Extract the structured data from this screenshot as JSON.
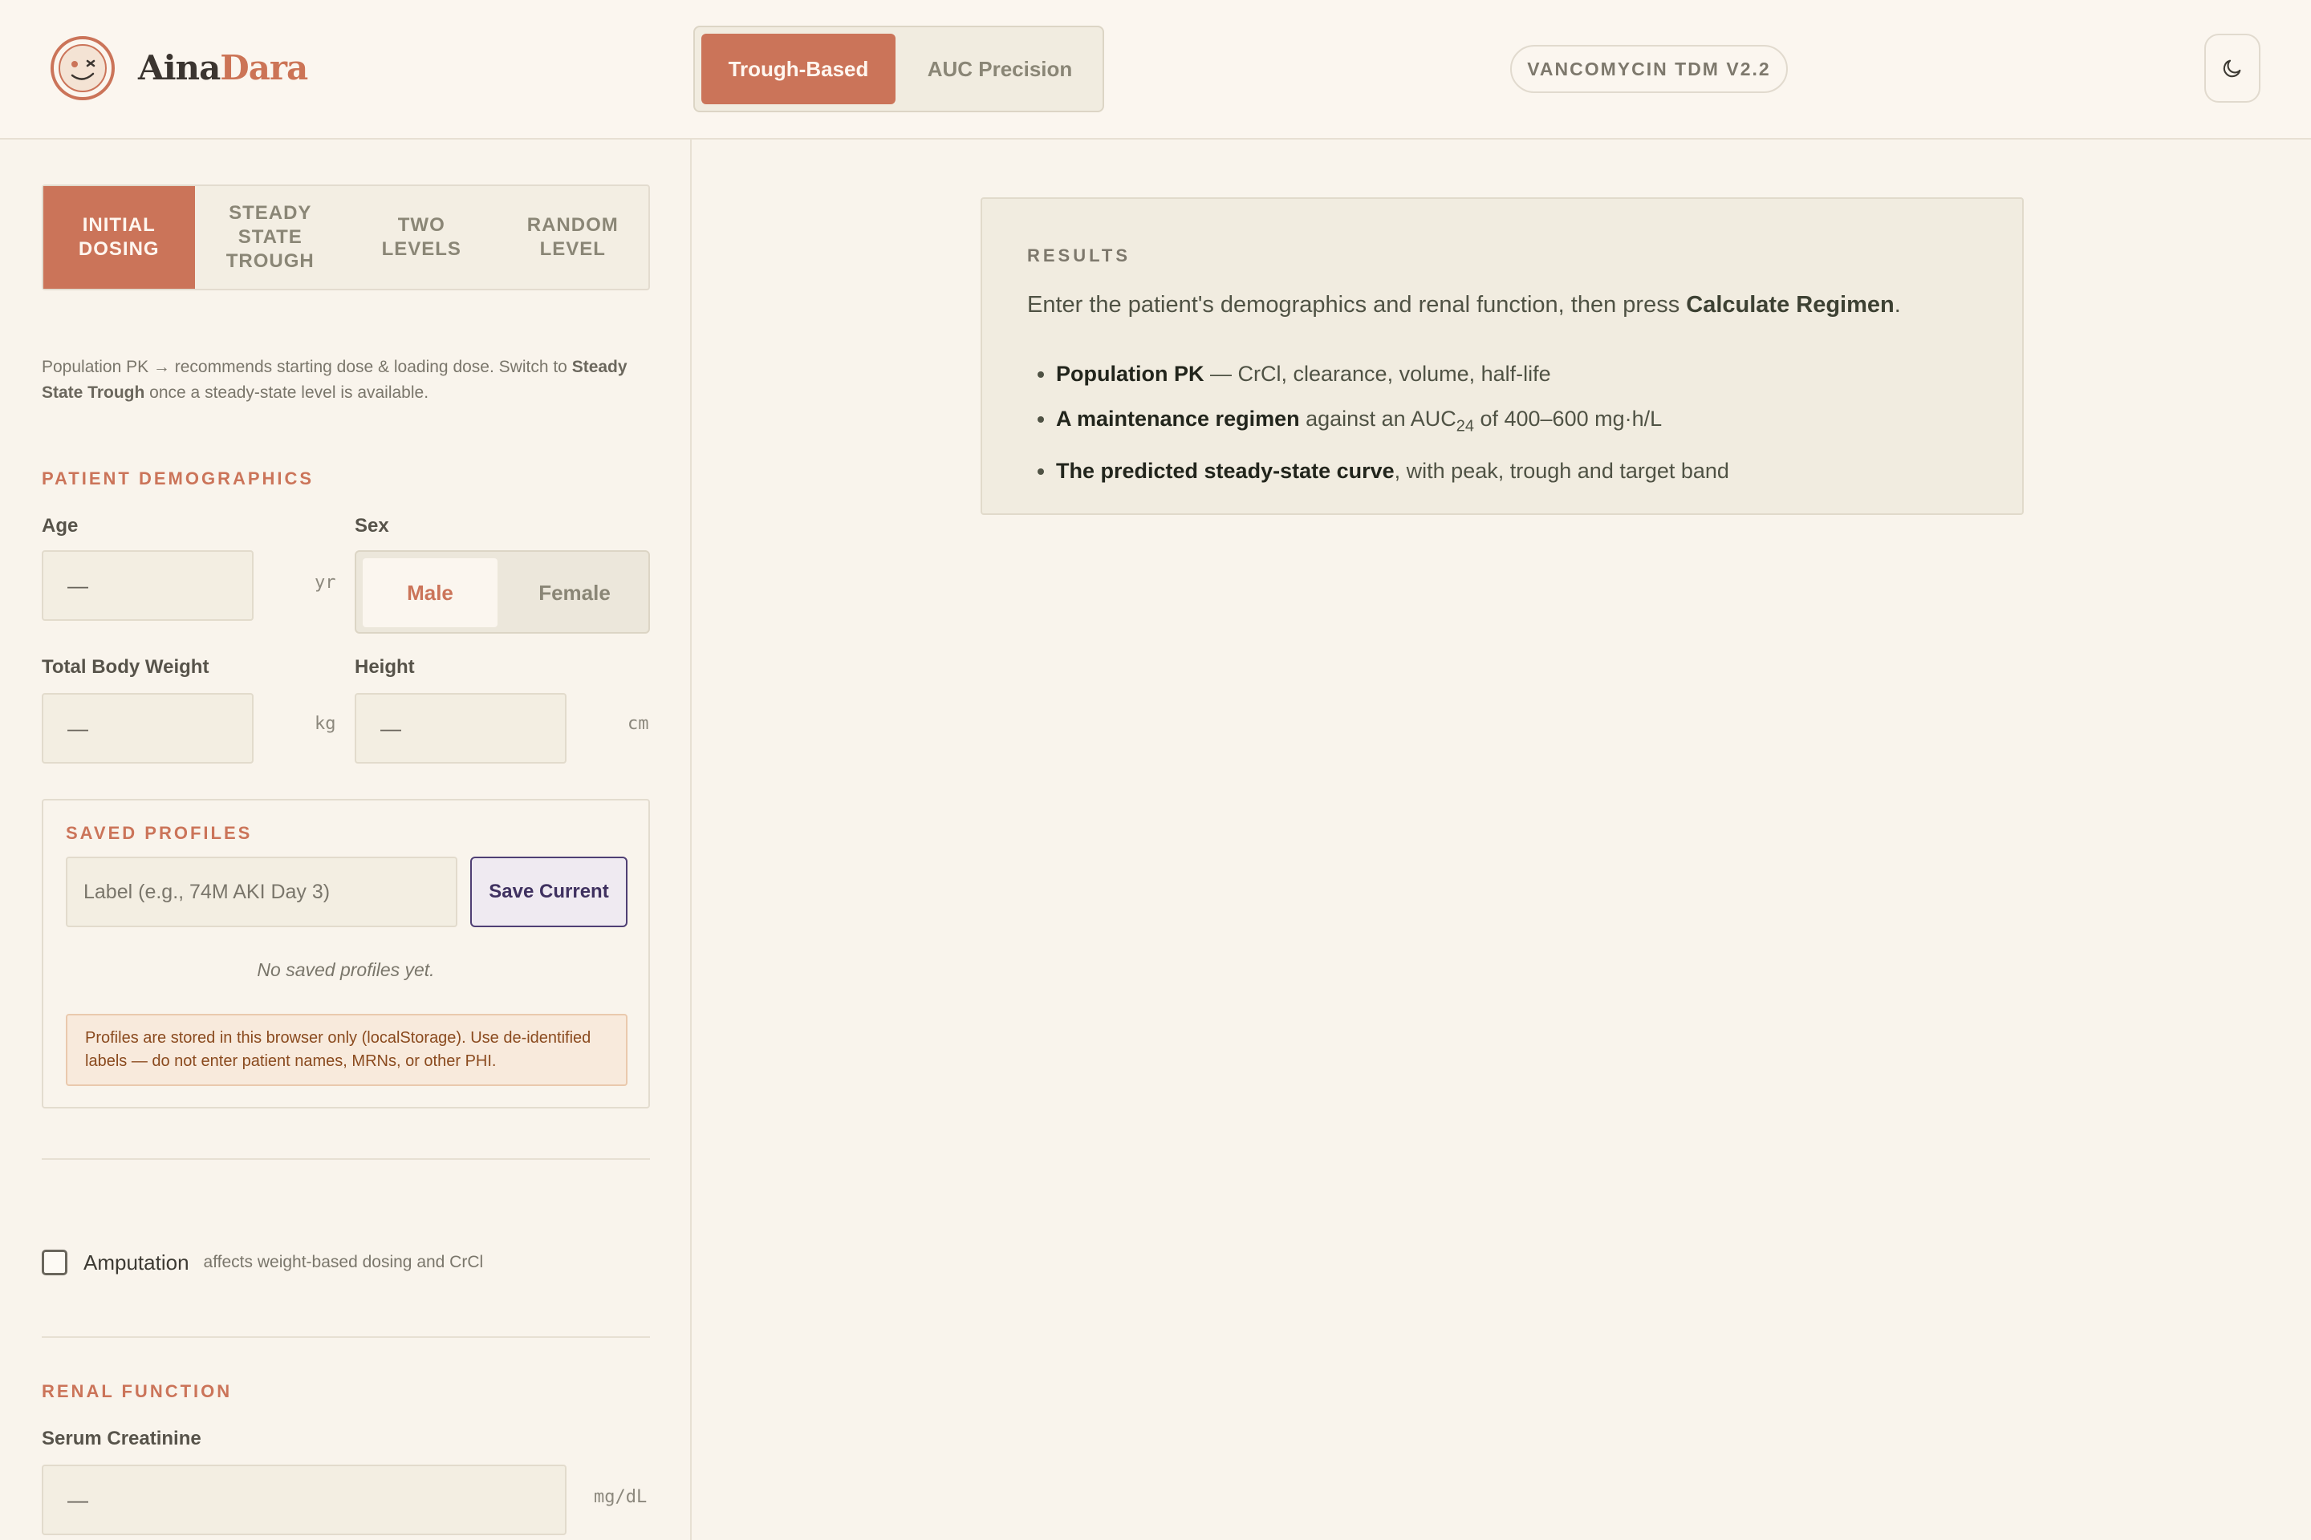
{
  "brand": {
    "part1": "Aina",
    "part2": "Dara"
  },
  "mode": {
    "options": [
      "Trough-Based",
      "AUC Precision"
    ],
    "selected": "Trough-Based"
  },
  "version": "VANCOMYCIN TDM V2.2",
  "tabs": [
    {
      "label": "INITIAL\nDOSING",
      "active": true
    },
    {
      "label": "STEADY\nSTATE\nTROUGH",
      "active": false
    },
    {
      "label": "TWO\nLEVELS",
      "active": false
    },
    {
      "label": "RANDOM\nLEVEL",
      "active": false
    }
  ],
  "hint": {
    "pre": "Population PK → recommends starting dose & loading dose. Switch to ",
    "bold": "Steady State Trough",
    "post": " once a steady-state level is available."
  },
  "demographics": {
    "title": "PATIENT DEMOGRAPHICS",
    "age": {
      "label": "Age",
      "value": "—",
      "unit": "yr"
    },
    "sex": {
      "label": "Sex",
      "options": [
        "Male",
        "Female"
      ],
      "selected": "Male"
    },
    "weight": {
      "label": "Total Body Weight",
      "value": "—",
      "unit": "kg"
    },
    "height": {
      "label": "Height",
      "value": "—",
      "unit": "cm"
    }
  },
  "profiles": {
    "title": "SAVED PROFILES",
    "placeholder": "Label (e.g., 74M AKI Day 3)",
    "save_label": "Save Current",
    "empty": "No saved profiles yet.",
    "warning": "Profiles are stored in this browser only (localStorage). Use de-identified labels — do not enter patient names, MRNs, or other PHI."
  },
  "amputation": {
    "label": "Amputation",
    "note": "affects weight-based dosing and CrCl",
    "checked": false
  },
  "renal": {
    "title": "RENAL FUNCTION",
    "scr": {
      "label": "Serum Creatinine",
      "value": "—",
      "unit": "mg/dL"
    }
  },
  "results": {
    "title": "RESULTS",
    "lead_pre": "Enter the patient's demographics and renal function, then press ",
    "lead_bold": "Calculate Regimen",
    "lead_post": ".",
    "items": [
      {
        "bold": "Population PK",
        "text": " — CrCl, clearance, volume, half-life"
      },
      {
        "bold": "A maintenance regimen",
        "text_pre": " against an AUC",
        "sub": "24",
        "text_post": " of 400–600 mg·h/L"
      },
      {
        "bold": "The predicted steady-state curve",
        "text": ", with peak, trough and target band"
      }
    ]
  },
  "colors": {
    "accent": "#cb7459",
    "background": "#f9f4ec",
    "panel": "#f1ece0",
    "save_border": "#4f3f74"
  }
}
